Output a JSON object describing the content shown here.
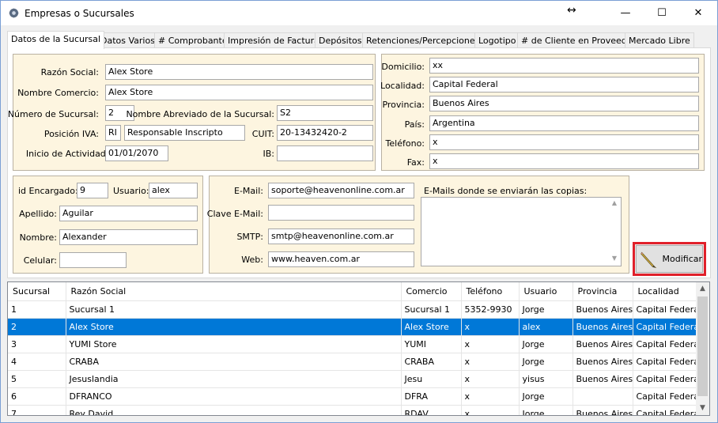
{
  "window": {
    "title": "Empresas o Sucursales",
    "minimize": "—",
    "maximize": "☐",
    "close": "✕",
    "resize_glyph": "↔"
  },
  "tabs": [
    {
      "label": "Datos de la Sucursal",
      "active": true
    },
    {
      "label": "Datos Varios"
    },
    {
      "label": "# Comprobantes"
    },
    {
      "label": "Impresión de Facturas"
    },
    {
      "label": "Depósitos"
    },
    {
      "label": "Retenciones/Percepciones"
    },
    {
      "label": "Logotipo"
    },
    {
      "label": "# de Cliente en Proveedor"
    },
    {
      "label": "Mercado Libre"
    }
  ],
  "company": {
    "razon_social_label": "Razón Social:",
    "razon_social": "Alex Store",
    "nombre_comercio_label": "Nombre Comercio:",
    "nombre_comercio": "Alex Store",
    "numero_sucursal_label": "Número de Sucursal:",
    "numero_sucursal": "2",
    "nombre_abreviado_label": "Nombre Abreviado de la Sucursal:",
    "nombre_abreviado": "S2",
    "posicion_iva_label": "Posición IVA:",
    "posicion_iva_code": "RI",
    "posicion_iva": "Responsable Inscripto",
    "cuit_label": "CUIT:",
    "cuit": "20-13432420-2",
    "inicio_label": "Inicio de Actividades:",
    "inicio": "01/01/2070",
    "ib_label": "IB:",
    "ib": ""
  },
  "address": {
    "domicilio_label": "Domicilio:",
    "domicilio": "xx",
    "localidad_label": "Localidad:",
    "localidad": "Capital Federal",
    "provincia_label": "Provincia:",
    "provincia": "Buenos Aires",
    "pais_label": "País:",
    "pais": "Argentina",
    "telefono_label": "Teléfono:",
    "telefono": "x",
    "fax_label": "Fax:",
    "fax": "x"
  },
  "manager": {
    "id_label": "id Encargado:",
    "id": "9",
    "usuario_label": "Usuario:",
    "usuario": "alex",
    "apellido_label": "Apellido:",
    "apellido": "Aguilar",
    "nombre_label": "Nombre:",
    "nombre": "Alexander",
    "celular_label": "Celular:",
    "celular": ""
  },
  "email": {
    "email_label": "E-Mail:",
    "email": "soporte@heavenonline.com.ar",
    "clave_label": "Clave E-Mail:",
    "clave": "",
    "smtp_label": "SMTP:",
    "smtp": "smtp@heavenonline.com.ar",
    "web_label": "Web:",
    "web": "www.heaven.com.ar",
    "copias_label": "E-Mails donde se enviarán las copias:",
    "copias": ""
  },
  "modify_button": {
    "label": "Modificar",
    "icon": "pencil-icon"
  },
  "grid": {
    "columns": [
      "Sucursal",
      "Razón Social",
      "Comercio",
      "Teléfono",
      "Usuario",
      "Provincia",
      "Localidad"
    ],
    "rows": [
      [
        "1",
        "Sucursal 1",
        "Sucursal 1",
        "5352-9930",
        "Jorge",
        "Buenos Aires",
        "Capital Federal"
      ],
      [
        "2",
        "Alex Store",
        "Alex Store",
        "x",
        "alex",
        "Buenos Aires",
        "Capital Federal"
      ],
      [
        "3",
        "YUMI Store",
        "YUMI",
        "x",
        "Jorge",
        "Buenos Aires",
        "Capital Federal"
      ],
      [
        "4",
        "CRABA",
        "CRABA",
        "x",
        "Jorge",
        "Buenos Aires",
        "Capital Federal"
      ],
      [
        "5",
        "Jesuslandia",
        "Jesu",
        "x",
        "yisus",
        "Buenos Aires",
        "Capital Federal"
      ],
      [
        "6",
        "DFRANCO",
        "DFRA",
        "x",
        "Jorge",
        "",
        "Capital Federal"
      ],
      [
        "7",
        "Rey David",
        "RDAV",
        "x",
        "Jorge",
        "Buenos Aires",
        "Capital Federal"
      ]
    ],
    "selected_row": 1
  },
  "colors": {
    "panel_bg": "#fdf5e0",
    "selection": "#0078d7",
    "highlight_border": "#e0202a"
  }
}
